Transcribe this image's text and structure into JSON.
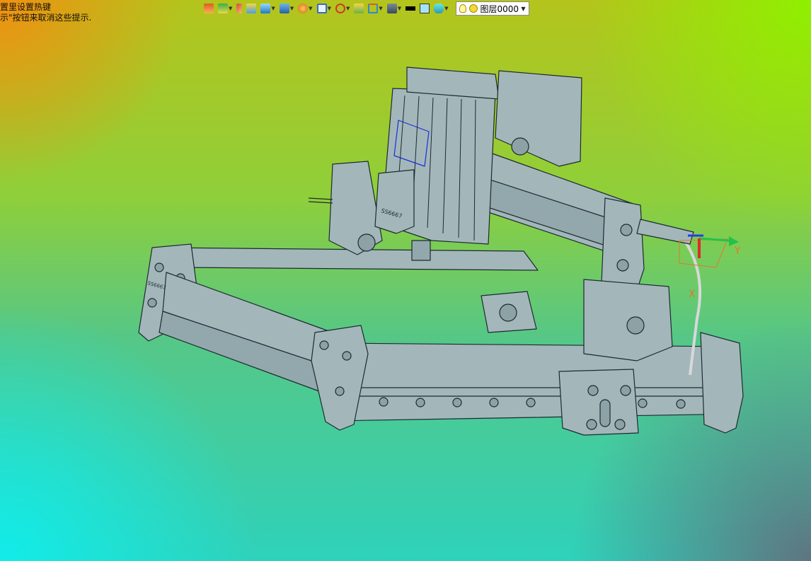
{
  "hints": {
    "line1": "置里设置热键",
    "line2": "示\"按钮来取消这些提示."
  },
  "layer": {
    "name": "图层0000"
  },
  "triad": {
    "y_label": "Y",
    "x_label": "X"
  },
  "model": {
    "engraving": "SS6667"
  },
  "colors": {
    "line_color": "#000000",
    "fill_color": "#a6e2f4",
    "model_color": "#9fb4b8"
  },
  "toolbar_icons": [
    "layer-icon",
    "color-icon",
    "pen-icon",
    "box-icon",
    "cube-icon",
    "view-icon",
    "render-icon",
    "zoom-icon",
    "snap-icon",
    "grid-icon",
    "frame-icon",
    "display-icon"
  ]
}
